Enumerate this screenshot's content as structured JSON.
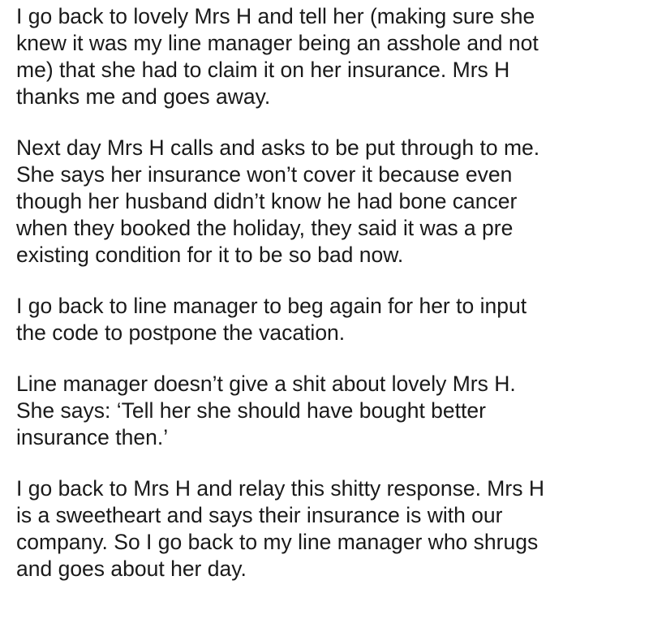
{
  "paragraphs": [
    {
      "lines": [
        "I go back to lovely Mrs H and tell her (making sure she",
        "knew it was my line manager being an asshole and not",
        "me) that she had to claim it on her insurance. Mrs H",
        "thanks me and goes away."
      ]
    },
    {
      "lines": [
        "Next day Mrs H calls and asks to be put through to me.",
        "She says her insurance won’t cover it because even",
        "though her husband didn’t know he had bone cancer",
        "when they booked the holiday, they said it was a pre",
        "existing condition for it to be so bad now."
      ]
    },
    {
      "lines": [
        "I go back to line manager to beg again for her to input",
        "the code to postpone the vacation."
      ]
    },
    {
      "lines": [
        "Line manager doesn’t give a shit about lovely Mrs H.",
        "She says: ‘Tell her she should have bought better",
        "insurance then.’"
      ]
    },
    {
      "lines": [
        "I go back to Mrs H and relay this shitty response. Mrs H",
        "is a sweetheart and says their insurance is with our",
        "company. So I go back to my line manager who shrugs",
        "and goes about her day."
      ]
    }
  ]
}
